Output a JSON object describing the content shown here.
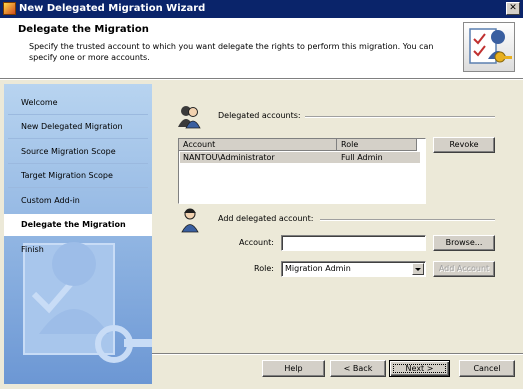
{
  "window": {
    "title": "New Delegated Migration Wizard",
    "close_glyph": "✕"
  },
  "header": {
    "title": "Delegate the Migration",
    "description": "Specify the trusted account to which you want delegate the rights to perform this migration. You can specify one or more accounts."
  },
  "sidebar": {
    "items": [
      {
        "label": "Welcome",
        "active": false
      },
      {
        "label": "New Delegated Migration",
        "active": false
      },
      {
        "label": "Source Migration Scope",
        "active": false
      },
      {
        "label": "Target Migration Scope",
        "active": false
      },
      {
        "label": "Custom Add-in",
        "active": false
      },
      {
        "label": "Delegate the Migration",
        "active": true
      },
      {
        "label": "Finish",
        "active": false
      }
    ]
  },
  "delegated_accounts": {
    "label": "Delegated accounts:",
    "columns": [
      "Account",
      "Role"
    ],
    "rows": [
      {
        "account": "NANTOU\\Administrator",
        "role": "Full Admin"
      }
    ],
    "revoke_button": "Revoke"
  },
  "add_account": {
    "label": "Add delegated account:",
    "account_label": "Account:",
    "account_value": "",
    "browse_button": "Browse...",
    "role_label": "Role:",
    "role_value": "Migration Admin",
    "add_button": "Add Account"
  },
  "footer": {
    "help": "Help",
    "back": "< Back",
    "next": "Next >",
    "cancel": "Cancel"
  }
}
